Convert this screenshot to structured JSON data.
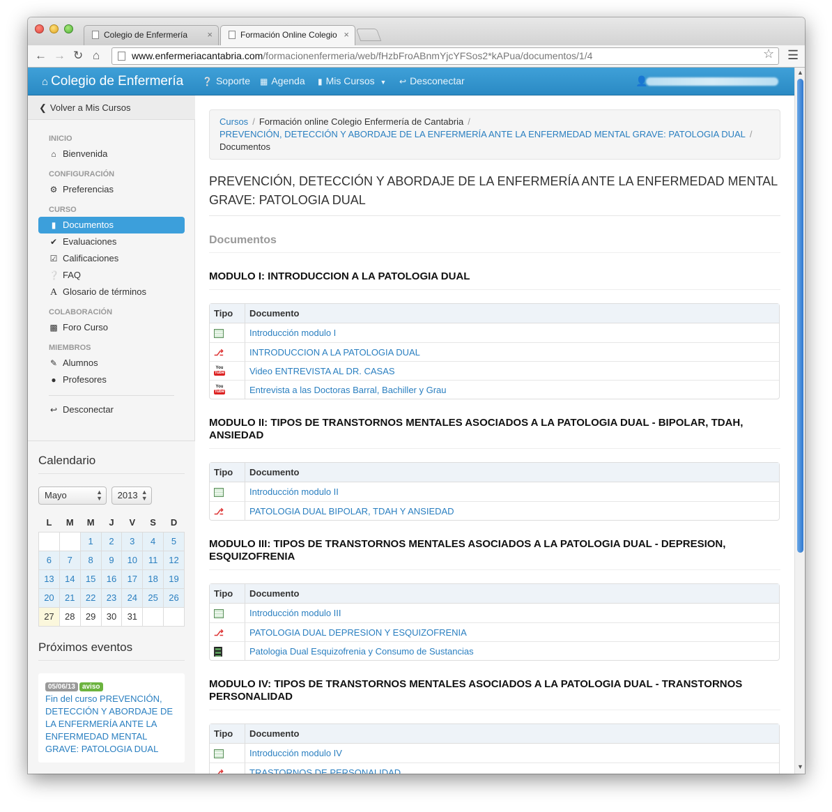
{
  "browser": {
    "tabs": [
      {
        "title": "Colegio de Enfermería"
      },
      {
        "title": "Formación Online Colegio"
      }
    ],
    "close_glyph": "×",
    "url_host": "www.enfermeriacantabria.com",
    "url_path": "/formacionenfermeria/web/fHzbFroABnmYjcYFSos2*kAPua/documentos/1/4"
  },
  "navbar": {
    "brand": "Colegio de Enfermería",
    "items": [
      {
        "label": "Soporte",
        "icon": "question-circle-icon"
      },
      {
        "label": "Agenda",
        "icon": "calendar-icon"
      },
      {
        "label": "Mis Cursos",
        "icon": "book-icon"
      },
      {
        "label": "Desconectar",
        "icon": "logout-icon"
      }
    ]
  },
  "sidebar": {
    "back_label": "Volver a Mis Cursos",
    "sections": [
      {
        "header": "INICIO",
        "items": [
          {
            "label": "Bienvenida",
            "icon": "home-icon"
          }
        ]
      },
      {
        "header": "CONFIGURACIÓN",
        "items": [
          {
            "label": "Preferencias",
            "icon": "gear-icon"
          }
        ]
      },
      {
        "header": "CURSO",
        "items": [
          {
            "label": "Documentos",
            "icon": "file-icon",
            "active": true
          },
          {
            "label": "Evaluaciones",
            "icon": "check-icon"
          },
          {
            "label": "Calificaciones",
            "icon": "check-square-icon"
          },
          {
            "label": "FAQ",
            "icon": "question-circle-icon"
          },
          {
            "label": "Glosario de términos",
            "icon": "font-icon"
          }
        ]
      },
      {
        "header": "COLABORACIÓN",
        "items": [
          {
            "label": "Foro Curso",
            "icon": "comment-icon"
          }
        ]
      },
      {
        "header": "MIEMBROS",
        "items": [
          {
            "label": "Alumnos",
            "icon": "pencil-icon"
          },
          {
            "label": "Profesores",
            "icon": "user-icon"
          }
        ]
      }
    ],
    "logout_label": "Desconectar"
  },
  "calendar": {
    "title": "Calendario",
    "month": "Mayo",
    "year": "2013",
    "weekdays": [
      "L",
      "M",
      "M",
      "J",
      "V",
      "S",
      "D"
    ],
    "weeks": [
      [
        "",
        "",
        "1",
        "2",
        "3",
        "4",
        "5"
      ],
      [
        "6",
        "7",
        "8",
        "9",
        "10",
        "11",
        "12"
      ],
      [
        "13",
        "14",
        "15",
        "16",
        "17",
        "18",
        "19"
      ],
      [
        "20",
        "21",
        "22",
        "23",
        "24",
        "25",
        "26"
      ],
      [
        "27",
        "28",
        "29",
        "30",
        "31",
        "",
        ""
      ]
    ],
    "today": "27"
  },
  "events": {
    "title": "Próximos eventos",
    "items": [
      {
        "date": "05/06/13",
        "badge": "aviso",
        "text": "Fin del curso PREVENCIÓN, DETECCIÓN Y ABORDAJE DE LA ENFERMERÍA ANTE LA ENFERMEDAD MENTAL GRAVE: PATOLOGIA DUAL"
      }
    ]
  },
  "breadcrumb": {
    "items": [
      "Cursos",
      "Formación online Colegio Enfermería de Cantabria",
      "PREVENCIÓN, DETECCIÓN Y ABORDAJE DE LA ENFERMERÍA ANTE LA ENFERMEDAD MENTAL GRAVE: PATOLOGIA DUAL",
      "Documentos"
    ],
    "separator": "/"
  },
  "page": {
    "title": "PREVENCIÓN, DETECCIÓN Y ABORDAJE DE LA ENFERMERÍA ANTE LA ENFERMEDAD MENTAL GRAVE: PATOLOGIA DUAL",
    "section": "Documentos",
    "col_tipo": "Tipo",
    "col_documento": "Documento",
    "modules": [
      {
        "title": "MODULO I: INTRODUCCION A LA PATOLOGIA DUAL",
        "docs": [
          {
            "type": "document-icon",
            "name": "Introducción modulo I"
          },
          {
            "type": "pdf-icon",
            "name": "INTRODUCCION A LA PATOLOGIA DUAL"
          },
          {
            "type": "youtube-icon",
            "name": "Video ENTREVISTA AL DR. CASAS"
          },
          {
            "type": "youtube-icon",
            "name": "Entrevista a las Doctoras Barral, Bachiller y Grau"
          }
        ]
      },
      {
        "title": "MODULO II: TIPOS DE TRANSTORNOS MENTALES ASOCIADOS A LA PATOLOGIA DUAL - BIPOLAR, TDAH, ANSIEDAD",
        "docs": [
          {
            "type": "document-icon",
            "name": "Introducción modulo II"
          },
          {
            "type": "pdf-icon",
            "name": "PATOLOGIA DUAL BIPOLAR, TDAH Y ANSIEDAD"
          }
        ]
      },
      {
        "title": "MODULO III: TIPOS DE TRANSTORNOS MENTALES ASOCIADOS A LA PATOLOGIA DUAL - DEPRESION, ESQUIZOFRENIA",
        "docs": [
          {
            "type": "document-icon",
            "name": "Introducción modulo III"
          },
          {
            "type": "pdf-icon",
            "name": "PATOLOGIA DUAL DEPRESION Y ESQUIZOFRENIA"
          },
          {
            "type": "film-icon",
            "name": "Patologia Dual Esquizofrenia y Consumo de Sustancias"
          }
        ]
      },
      {
        "title": "MODULO IV: TIPOS DE TRANSTORNOS MENTALES ASOCIADOS A LA PATOLOGIA DUAL - TRANSTORNOS PERSONALIDAD",
        "docs": [
          {
            "type": "document-icon",
            "name": "Introducción modulo IV"
          },
          {
            "type": "pdf-icon",
            "name": "TRASTORNOS DE PERSONALIDAD"
          }
        ]
      }
    ]
  },
  "colors": {
    "navbar": "#2a8ac4",
    "link": "#2a7fc0",
    "active": "#3c9fdb"
  }
}
